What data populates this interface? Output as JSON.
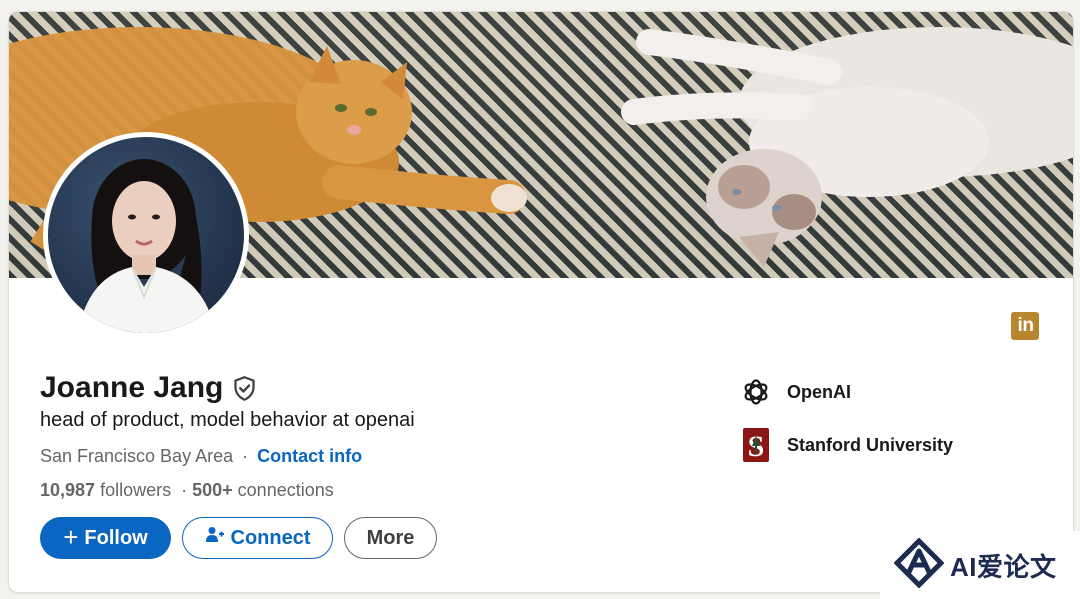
{
  "profile": {
    "name": "Joanne Jang",
    "headline": "head of product, model behavior at openai",
    "location": "San Francisco Bay Area",
    "separator": "·",
    "contact_info": "Contact info",
    "followers_count": "10,987",
    "followers_label": "followers",
    "connections_count": "500+",
    "connections_label": "connections"
  },
  "actions": {
    "follow": "Follow",
    "connect": "Connect",
    "more": "More"
  },
  "organizations": [
    {
      "name": "OpenAI",
      "logo": "openai-logo"
    },
    {
      "name": "Stanford University",
      "logo": "stanford-logo"
    }
  ],
  "icons": {
    "linkedin": "in",
    "verified": "verified-shield-icon",
    "plus": "+"
  },
  "colors": {
    "brand_blue": "#0a66c2",
    "linkedin_icon_bg": "#b8862f",
    "stanford_red": "#8c1515",
    "watermark_navy": "#1c2b4f"
  },
  "watermark": {
    "text": "AI爱论文"
  }
}
